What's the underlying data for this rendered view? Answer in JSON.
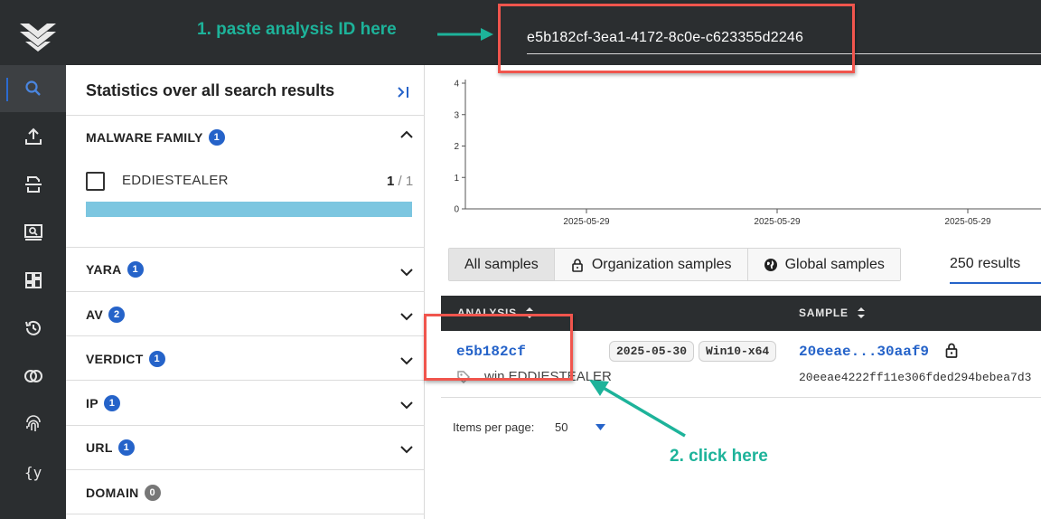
{
  "search": {
    "value": "e5b182cf-3ea1-4172-8c0e-c623355d2246"
  },
  "annotations": {
    "step1": "1. paste analysis ID here",
    "step2": "2. click here"
  },
  "nav": {
    "items": [
      "search-icon",
      "upload-icon",
      "scanner-icon",
      "monitor-search-icon",
      "dashboard-icon",
      "history-icon",
      "compare-icon",
      "fingerprint-icon",
      "yara-rules-icon"
    ],
    "active_index": 0
  },
  "stats": {
    "title": "Statistics over all search results",
    "sections": [
      {
        "label": "MALWARE FAMILY",
        "count": "1",
        "expanded": true
      },
      {
        "label": "YARA",
        "count": "1"
      },
      {
        "label": "AV",
        "count": "2"
      },
      {
        "label": "VERDICT",
        "count": "1"
      },
      {
        "label": "IP",
        "count": "1"
      },
      {
        "label": "URL",
        "count": "1"
      },
      {
        "label": "DOMAIN",
        "count": "0"
      }
    ],
    "family": {
      "name": "EDDIESTEALER",
      "count": "1",
      "total": "/ 1",
      "fraction": 1.0
    }
  },
  "chart_data": {
    "type": "bar",
    "y_ticks": [
      "0",
      "1",
      "2",
      "3",
      "4"
    ],
    "ylim": [
      0,
      4
    ],
    "x_ticks": [
      "2025-05-29",
      "2025-05-29",
      "2025-05-29"
    ],
    "values": []
  },
  "tabs": {
    "items": [
      "All samples",
      "Organization samples",
      "Global samples"
    ],
    "active_index": 0
  },
  "results": "250 results",
  "table": {
    "headers": {
      "analysis": "ANALYSIS",
      "sample": "SAMPLE"
    },
    "row": {
      "analysis_id": "e5b182cf",
      "date": "2025-05-30",
      "os": "Win10-x64",
      "tag": "win.EDDIESTEALER",
      "sample_short": "20eeae...30aaf9",
      "sample_hash": "20eeae4222ff11e306fded294bebea7d3"
    }
  },
  "pagination": {
    "label": "Items per page:",
    "value": "50"
  },
  "colors": {
    "accent": "#2563c9",
    "annotation": "#1db39a",
    "highlight": "#f0554d",
    "bar_fill": "#7cc6e0",
    "nav_bg": "#2b2e30"
  }
}
